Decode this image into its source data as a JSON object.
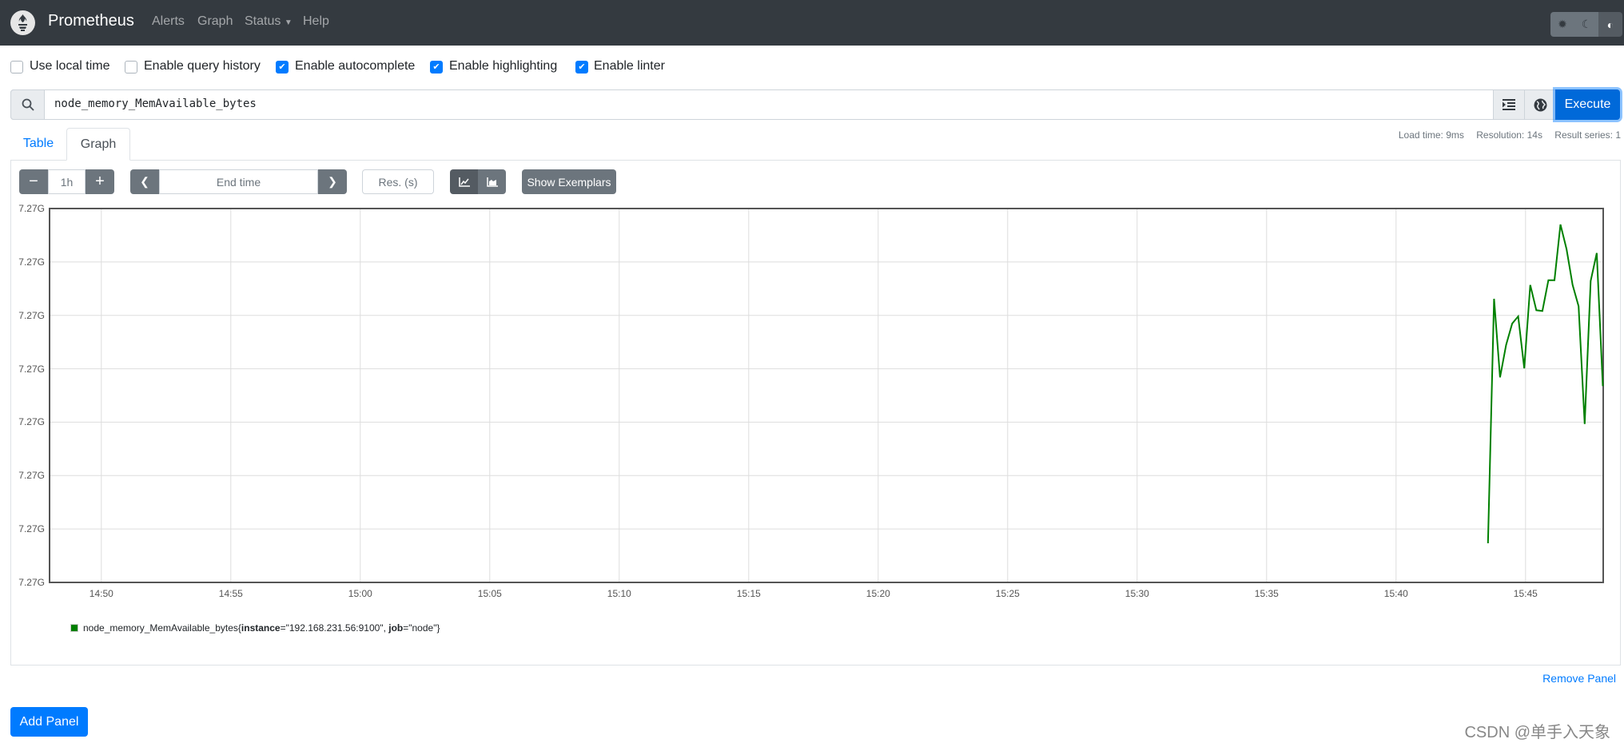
{
  "navbar": {
    "brand": "Prometheus",
    "links": [
      "Alerts",
      "Graph",
      "Status",
      "Help"
    ],
    "theme_icons": [
      "sun-icon",
      "moon-icon",
      "contrast-icon"
    ],
    "bg_color": "#343a40"
  },
  "options": [
    {
      "label": "Use local time",
      "checked": false
    },
    {
      "label": "Enable query history",
      "checked": false
    },
    {
      "label": "Enable autocomplete",
      "checked": true
    },
    {
      "label": "Enable highlighting",
      "checked": true
    },
    {
      "label": "Enable linter",
      "checked": true
    }
  ],
  "query": {
    "value": "node_memory_MemAvailable_bytes",
    "execute_label": "Execute",
    "accent": "#0069d9"
  },
  "tabs": [
    {
      "label": "Table",
      "active": false
    },
    {
      "label": "Graph",
      "active": true
    }
  ],
  "stats": {
    "load_time": "Load time: 9ms",
    "resolution": "Resolution: 14s",
    "result_series": "Result series: 1"
  },
  "controls": {
    "range": "1h",
    "end_time_placeholder": "End time",
    "res_placeholder": "Res. (s)",
    "show_exemplars": "Show Exemplars",
    "chart_mode": "lines"
  },
  "chart_data": {
    "type": "line",
    "xlim": [
      "14:48:00",
      "15:48:00"
    ],
    "x_ticks": [
      "14:50",
      "14:55",
      "15:00",
      "15:05",
      "15:10",
      "15:15",
      "15:20",
      "15:25",
      "15:30",
      "15:35",
      "15:40",
      "15:45"
    ],
    "y_ticks": [
      "7.27G",
      "7.27G",
      "7.27G",
      "7.27G",
      "7.27G",
      "7.27G",
      "7.27G",
      "7.27G"
    ],
    "ylim": [
      7269900000,
      7270600000
    ],
    "grid": true,
    "legend_placement": "bottom-left",
    "series": [
      {
        "name": "node_memory_MemAvailable_bytes{instance=\"192.168.231.56:9100\", job=\"node\"}",
        "color": "#008000",
        "x": [
          "15:43:33",
          "15:43:47",
          "15:44:01",
          "15:44:15",
          "15:44:29",
          "15:44:43",
          "15:44:57",
          "15:45:11",
          "15:45:25",
          "15:45:39",
          "15:45:53",
          "15:46:07",
          "15:46:21",
          "15:46:35",
          "15:46:49",
          "15:47:03",
          "15:47:17",
          "15:47:31",
          "15:47:45",
          "15:47:59"
        ],
        "values": [
          7269973300,
          7270431000,
          7270284000,
          7270344700,
          7270384600,
          7270398100,
          7270300900,
          7270456900,
          7270409600,
          7270408100,
          7270465800,
          7270465800,
          7270570100,
          7270524200,
          7270456900,
          7270417100,
          7270196600,
          7270464300,
          7270516700,
          7270267500
        ]
      }
    ]
  },
  "legend": {
    "metric": "node_memory_MemAvailable_bytes",
    "open": "{",
    "k1": "instance",
    "v1": "=\"192.168.231.56:9100\", ",
    "k2": "job",
    "v2": "=\"node\"",
    "close": "}"
  },
  "remove_panel": "Remove Panel",
  "add_panel": "Add Panel",
  "watermark": "CSDN @单手入天象"
}
